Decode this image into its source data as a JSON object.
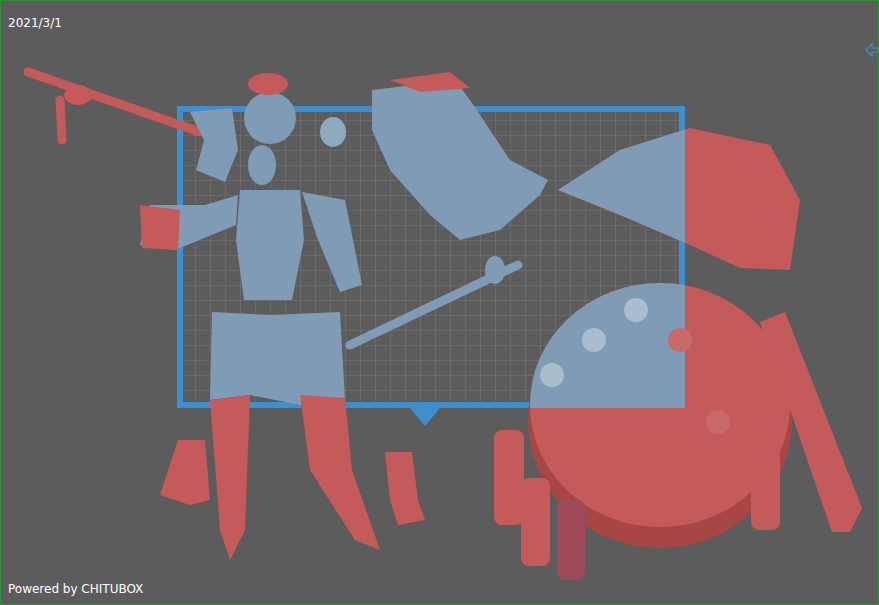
{
  "viewport": {
    "date": "2021/3/1",
    "footer": "Powered by CHITUBOX"
  }
}
